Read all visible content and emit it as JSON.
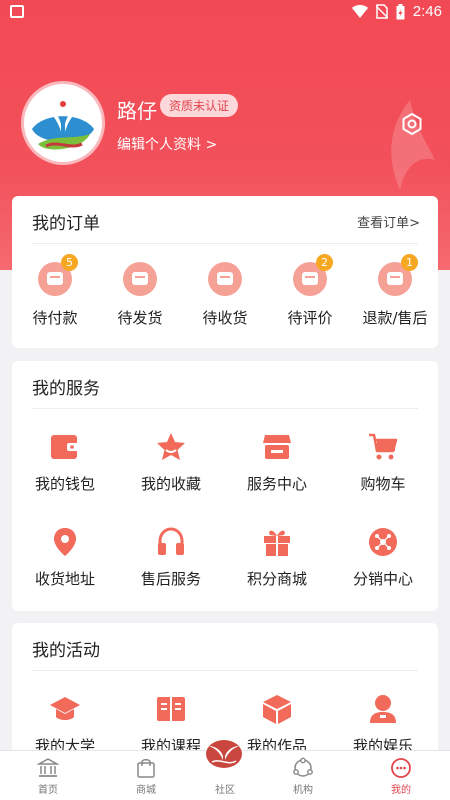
{
  "status_bar": {
    "time": "2:46"
  },
  "profile": {
    "username": "路仔",
    "badge": "资质未认证",
    "edit_label": "编辑个人资料  >"
  },
  "orders": {
    "title": "我的订单",
    "view_all": "查看订单>",
    "items": [
      {
        "label": "待付款",
        "badge": "5",
        "icon": "wallet-icon"
      },
      {
        "label": "待发货",
        "badge": "",
        "icon": "package-icon"
      },
      {
        "label": "待收货",
        "badge": "",
        "icon": "truck-icon"
      },
      {
        "label": "待评价",
        "badge": "2",
        "icon": "comment-icon"
      },
      {
        "label": "退款/售后",
        "badge": "1",
        "icon": "refund-icon"
      }
    ]
  },
  "services": {
    "title": "我的服务",
    "items": [
      {
        "label": "我的钱包",
        "icon": "wallet-icon"
      },
      {
        "label": "我的收藏",
        "icon": "star-icon"
      },
      {
        "label": "服务中心",
        "icon": "store-icon"
      },
      {
        "label": "购物车",
        "icon": "cart-icon"
      },
      {
        "label": "收货地址",
        "icon": "location-icon"
      },
      {
        "label": "售后服务",
        "icon": "headphones-icon"
      },
      {
        "label": "积分商城",
        "icon": "gift-icon"
      },
      {
        "label": "分销中心",
        "icon": "share-network-icon"
      }
    ]
  },
  "activities": {
    "title": "我的活动",
    "items": [
      {
        "label": "我的大学",
        "icon": "graduation-cap-icon"
      },
      {
        "label": "我的课程",
        "icon": "book-icon"
      },
      {
        "label": "我的作品",
        "icon": "box-icon"
      },
      {
        "label": "我的娱乐",
        "icon": "person-icon"
      }
    ]
  },
  "tabbar": {
    "items": [
      {
        "label": "首页",
        "icon": "bank-icon",
        "active": false
      },
      {
        "label": "商城",
        "icon": "shopping-bag-icon",
        "active": false
      },
      {
        "label": "社区",
        "icon": "community-logo-icon",
        "active": false
      },
      {
        "label": "机构",
        "icon": "organization-icon",
        "active": false
      },
      {
        "label": "我的",
        "icon": "smiley-icon",
        "active": true
      }
    ]
  },
  "colors": {
    "brand": "#f24a55",
    "icon_accent": "#f26a5a",
    "badge_orange": "#f7a823"
  }
}
